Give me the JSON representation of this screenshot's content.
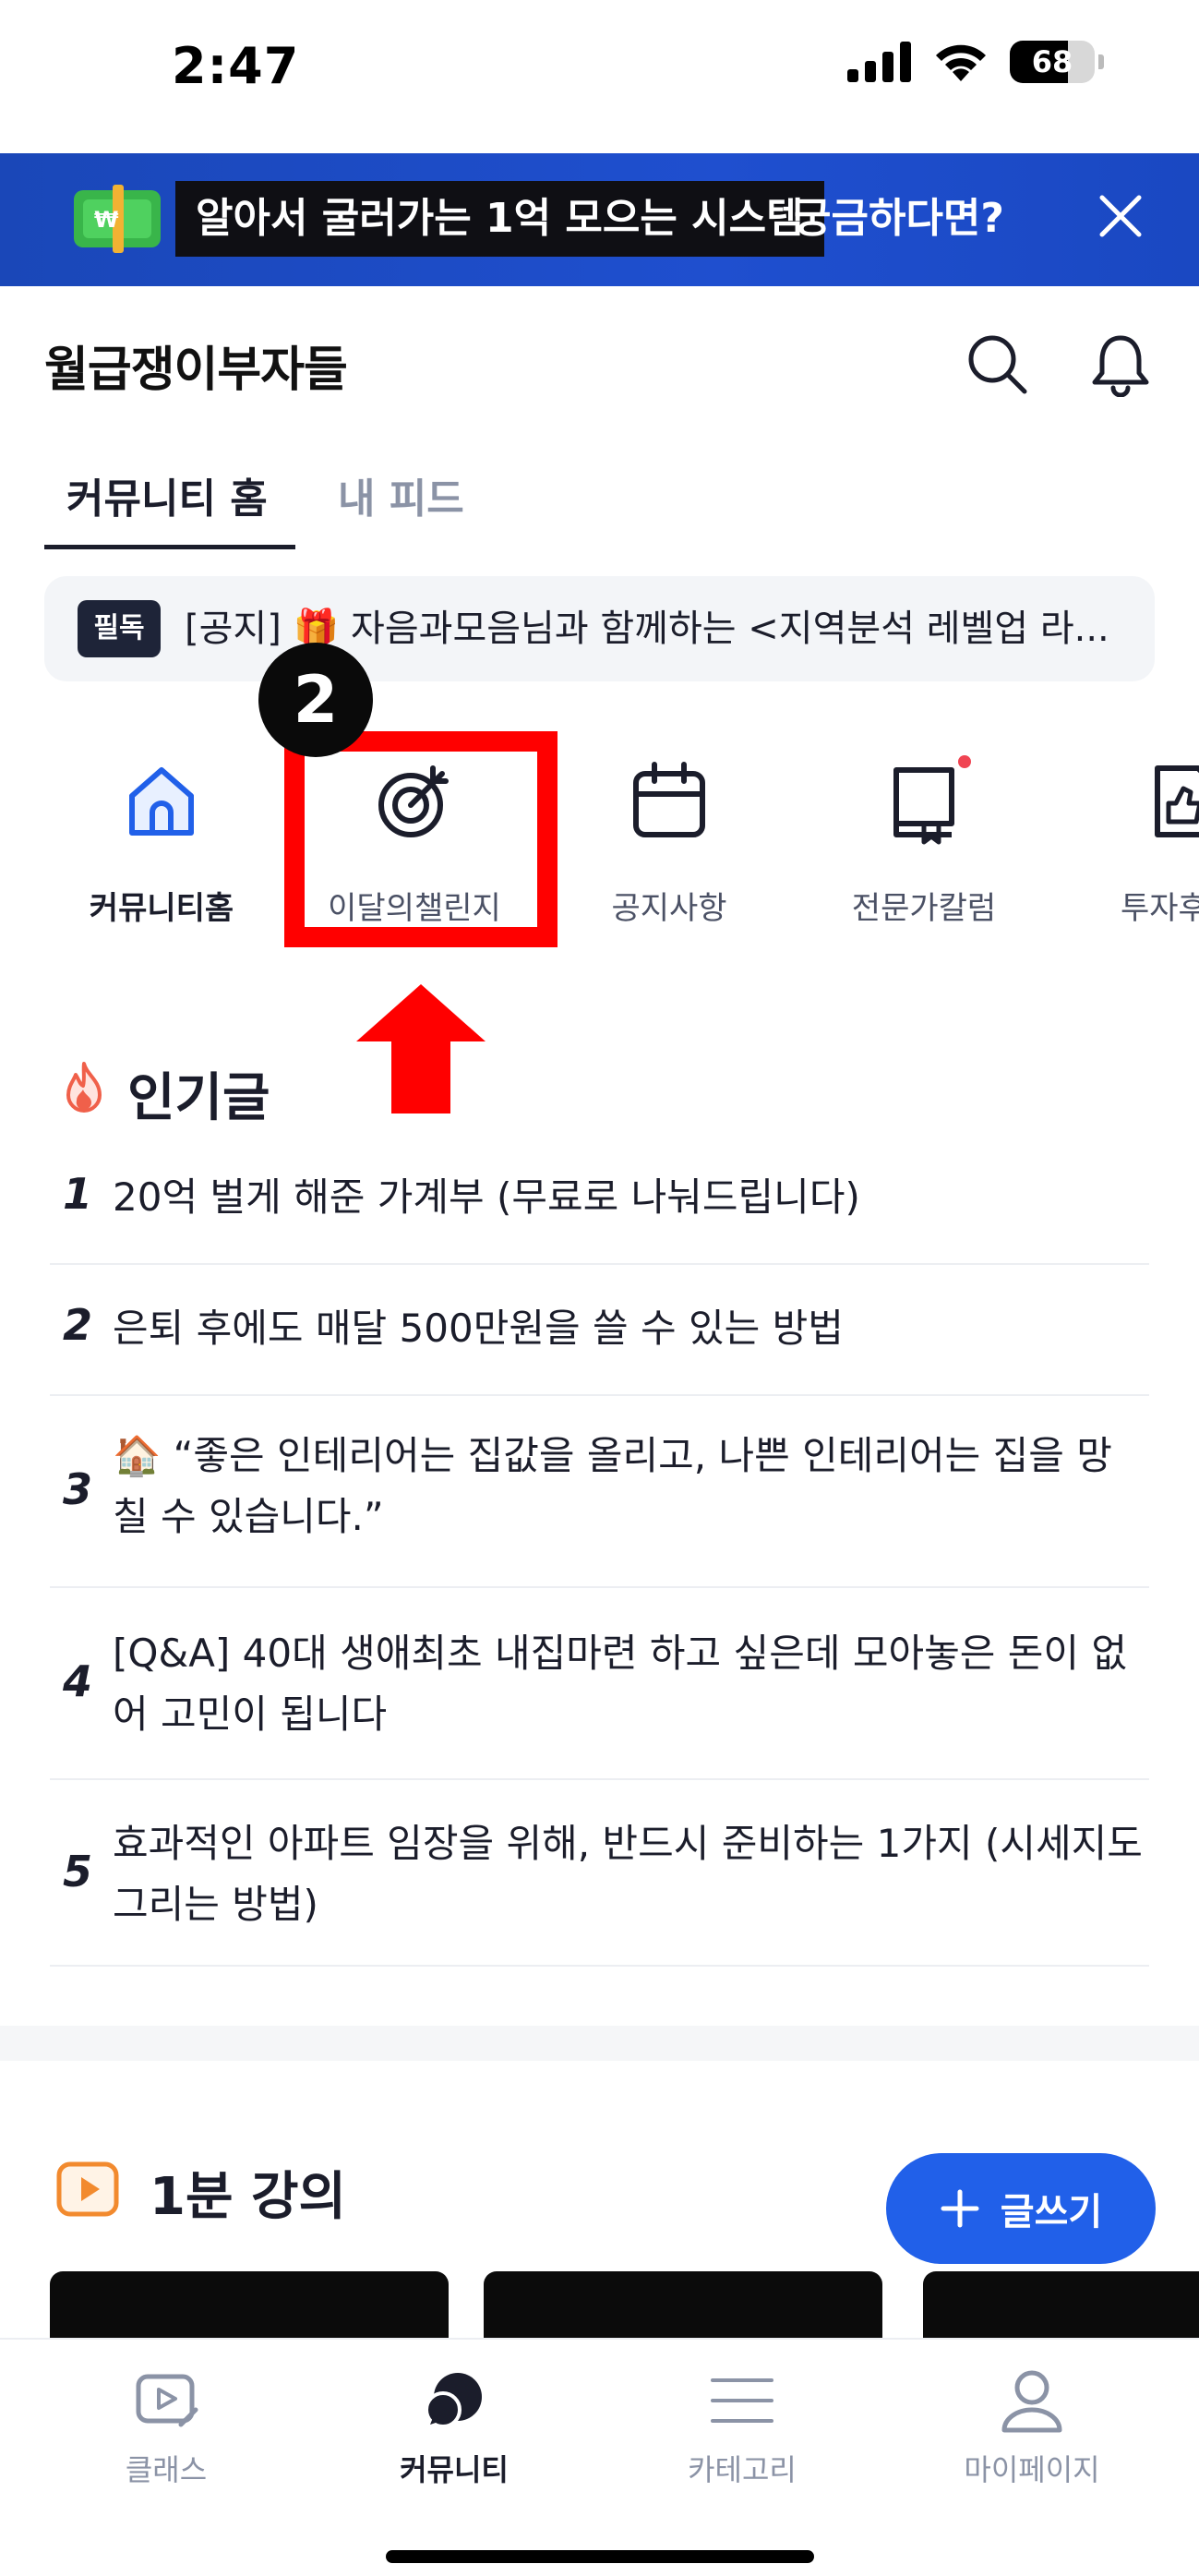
{
  "status_bar": {
    "time": "2:47",
    "battery": "68"
  },
  "banner": {
    "highlight_text": "알아서 굴러가는 1억 모으는 시스템",
    "tail_text": "궁금하다면?",
    "icon": "money-icon",
    "close_icon": "close-icon"
  },
  "header": {
    "title": "월급쟁이부자들",
    "search_icon": "search-icon",
    "bell_icon": "bell-icon"
  },
  "tabs": [
    {
      "label": "커뮤니티 홈",
      "active": true
    },
    {
      "label": "내 피드",
      "active": false
    }
  ],
  "notice": {
    "badge": "필독",
    "text": "[공지] 🎁 자음과모음님과 함께하는 <지역분석 레벨업 라..."
  },
  "categories": [
    {
      "label": "커뮤니티홈",
      "icon": "home-icon"
    },
    {
      "label": "이달의챌린지",
      "icon": "target-icon"
    },
    {
      "label": "공지사항",
      "icon": "calendar-icon"
    },
    {
      "label": "전문가칼럼",
      "icon": "book-icon"
    },
    {
      "label": "투자후",
      "icon": "thumbs-up-icon"
    }
  ],
  "annotation": {
    "step_number": "2"
  },
  "popular": {
    "title": "인기글",
    "items": [
      {
        "rank": "1",
        "text": "20억 벌게 해준 가계부 (무료로 나눠드립니다)"
      },
      {
        "rank": "2",
        "text": "은퇴 후에도 매달 500만원을 쓸 수 있는 방법"
      },
      {
        "rank": "3",
        "text": "🏠 “좋은 인테리어는 집값을 올리고, 나쁜 인테리어는 집을 망칠 수 있습니다.”"
      },
      {
        "rank": "4",
        "text": "[Q&A] 40대 생애최초 내집마련 하고 싶은데 모아놓은 돈이 없어 고민이 됩니다"
      },
      {
        "rank": "5",
        "text": "효과적인 아파트 임장을 위해, 반드시 준비하는 1가지 (시세지도 그리는 방법)"
      }
    ]
  },
  "lecture": {
    "title": "1분 강의"
  },
  "write_button": {
    "label": "글쓰기"
  },
  "bottom_nav": [
    {
      "label": "클래스",
      "icon": "video-icon",
      "active": false
    },
    {
      "label": "커뮤니티",
      "icon": "chat-icon",
      "active": true
    },
    {
      "label": "카테고리",
      "icon": "menu-icon",
      "active": false
    },
    {
      "label": "마이페이지",
      "icon": "user-icon",
      "active": false
    }
  ],
  "colors": {
    "brand_blue": "#2160e9",
    "banner_blue": "#1f4fcf",
    "annotation_red": "#ff0000",
    "text_dark": "#1b1d2b"
  }
}
